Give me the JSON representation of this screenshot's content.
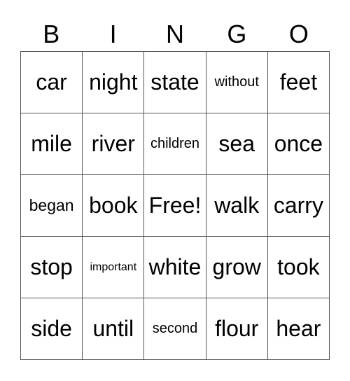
{
  "title_letters": [
    "B",
    "I",
    "N",
    "G",
    "O"
  ],
  "cells": [
    [
      "car",
      "night",
      "state",
      "without",
      "feet"
    ],
    [
      "mile",
      "river",
      "children",
      "sea",
      "once"
    ],
    [
      "began",
      "book",
      "Free!",
      "walk",
      "carry"
    ],
    [
      "stop",
      "important",
      "white",
      "grow",
      "took"
    ],
    [
      "side",
      "until",
      "second",
      "flour",
      "hear"
    ]
  ]
}
